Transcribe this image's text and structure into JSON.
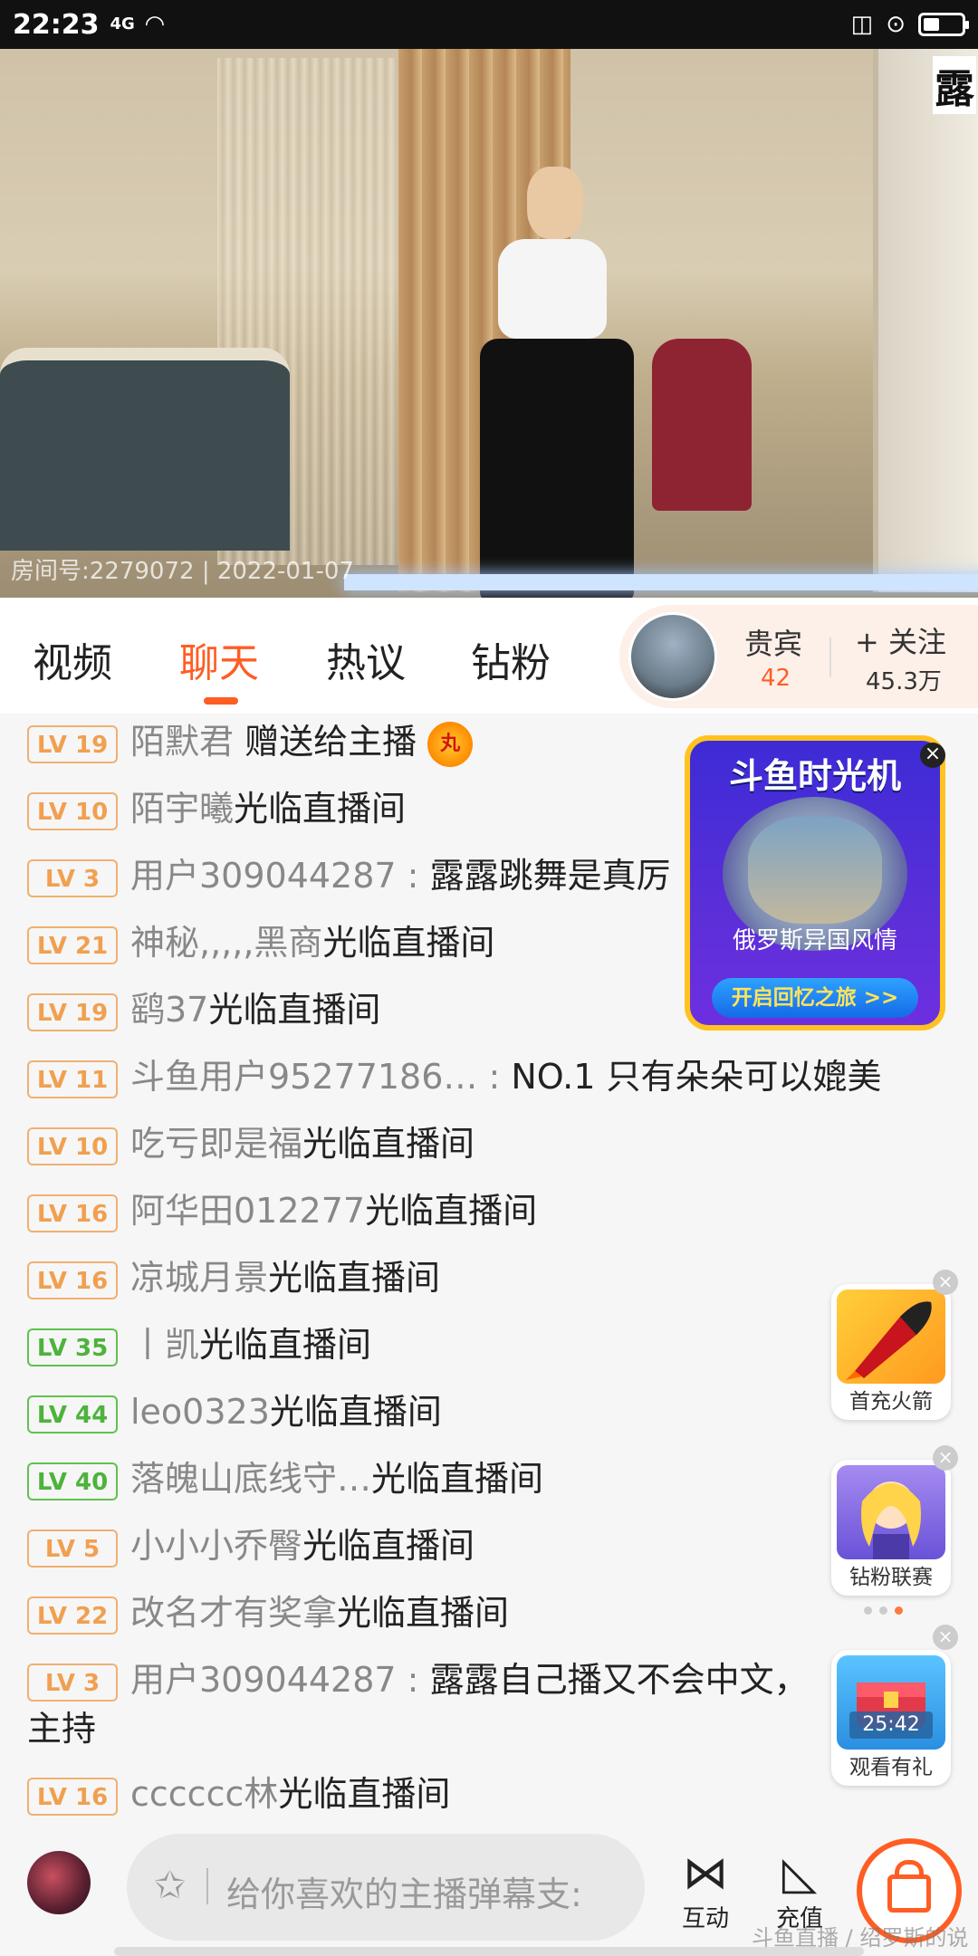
{
  "status_bar": {
    "time": "22:23",
    "network": "4G"
  },
  "video": {
    "corner_text": "露",
    "watermark": "房间号:2279072 | 2022-01-07"
  },
  "tabs": [
    {
      "label": "视频",
      "active": false
    },
    {
      "label": "聊天",
      "active": true
    },
    {
      "label": "热议",
      "active": false
    },
    {
      "label": "钻粉",
      "active": false
    }
  ],
  "host_card": {
    "vip_label": "贵宾",
    "vip_count": "42",
    "follow_label": "+ 关注",
    "follow_count": "45.3万"
  },
  "chat": [
    {
      "level": "LV 19",
      "user": "陌默君",
      "text": " 赠送给主播",
      "gift": "丸"
    },
    {
      "level": "LV 10",
      "user": "陌宇曦",
      "text": "光临直播间"
    },
    {
      "level": "LV 3",
      "user": "用户309044287 :",
      "text": " 露露跳舞是真厉"
    },
    {
      "level": "LV 21",
      "user": "神秘,,,,,黑商",
      "text": "光临直播间"
    },
    {
      "level": "LV 19",
      "user": "鹞37",
      "text": "光临直播间"
    },
    {
      "level": "LV 11",
      "user": "斗鱼用户95277186… :",
      "text": " NO.1  只有朵朵可以媲美"
    },
    {
      "level": "LV 10",
      "user": "吃亏即是福",
      "text": "光临直播间"
    },
    {
      "level": "LV 16",
      "user": "阿华田012277",
      "text": "光临直播间"
    },
    {
      "level": "LV 16",
      "user": "凉城月景",
      "text": "光临直播间"
    },
    {
      "level": "LV 35",
      "user": "丨凯",
      "text": "光临直播间"
    },
    {
      "level": "LV 44",
      "user": "leo0323",
      "text": "光临直播间"
    },
    {
      "level": "LV 40",
      "user": "落魄山底线守…",
      "text": "光临直播间"
    },
    {
      "level": "LV 5",
      "user": "小小小乔臀",
      "text": "光临直播间"
    },
    {
      "level": "LV 22",
      "user": "改名才有奖拿",
      "text": "光临直播间"
    },
    {
      "level": "LV 3",
      "user": "用户309044287 :",
      "text": " 露露自己播又不会中文，",
      "text2": "主持"
    },
    {
      "level": "LV 16",
      "user": "cccccc林",
      "text": "光临直播间"
    }
  ],
  "ad": {
    "title": "斗鱼时光机",
    "caption": "俄罗斯异国风情",
    "button": "开启回忆之旅 >>"
  },
  "side_items": [
    {
      "label": "首充火箭",
      "icon": "rocket-icon"
    },
    {
      "label": "钻粉联赛",
      "icon": "character-icon"
    },
    {
      "label": "观看有礼",
      "timer": "25:42",
      "icon": "treasure-chest-icon"
    }
  ],
  "bottom_bar": {
    "input_placeholder": "给你喜欢的主播弹幕支:",
    "interact_label": "互动",
    "charge_label": "充值"
  },
  "bottom_watermark": "斗鱼直播 / 绍罗斯的说",
  "colors": {
    "accent": "#ff5d23",
    "level_orange": "#f0a050",
    "level_green": "#4db33c"
  }
}
